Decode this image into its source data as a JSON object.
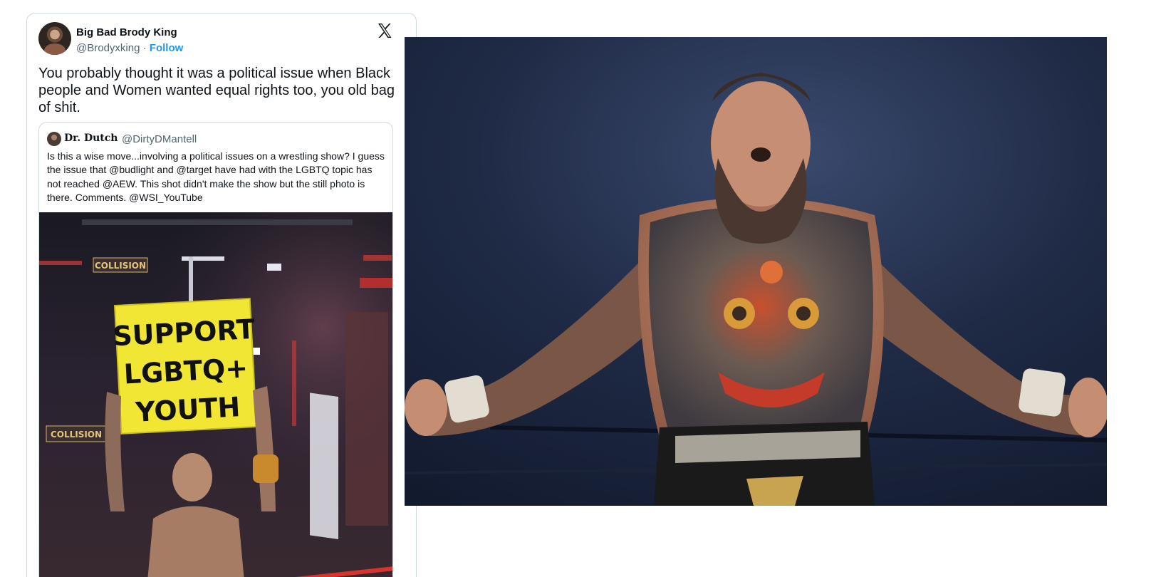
{
  "tweet": {
    "author_name": "Big Bad Brody King",
    "handle": "@Brodyxking",
    "separator": " · ",
    "follow_label": "Follow",
    "text": "You probably thought it was a political issue when Black people and Women wanted equal rights too, you old bag of shit.",
    "quoted": {
      "author_name": "Dr. Dutch",
      "handle": "@DirtyDMantell",
      "text": "Is this a wise move...involving a political issues on a wrestling show?  I guess the issue that @budlight and @target have had with the LGBTQ topic has  not reached @AEW.  This shot didn't make the show but the still photo is there.  Comments. @WSI_YouTube",
      "image": {
        "sign_lines": [
          "SUPPORT",
          "LGBTQ+",
          "YOUTH"
        ],
        "banner_text": "COLLISION"
      }
    }
  },
  "colors": {
    "link": "#1d9bf0",
    "secondary_text": "#536471",
    "border": "#cfd9de",
    "sign_yellow": "#f2e634"
  },
  "icons": {
    "brand": "x-logo-icon"
  }
}
